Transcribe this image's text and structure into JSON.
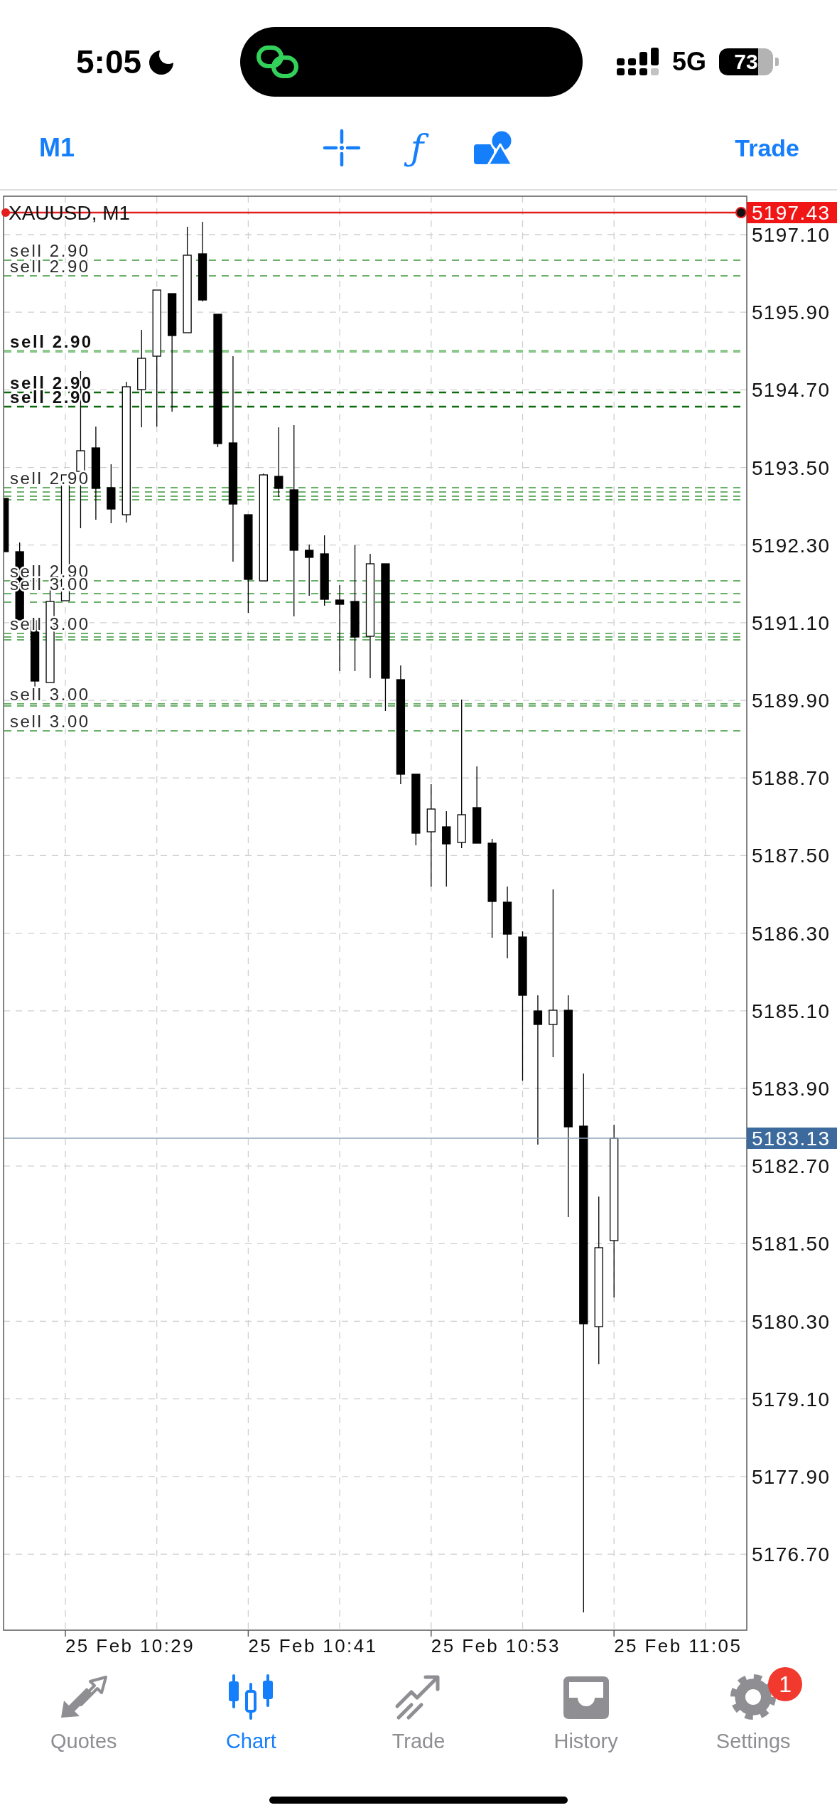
{
  "status_bar": {
    "time": "5:05",
    "network": "5G",
    "battery": "73"
  },
  "toolbar": {
    "timeframe": "M1",
    "function_button": "ƒ",
    "trade_button": "Trade"
  },
  "chart": {
    "symbol": "XAUUSD, M1",
    "price_line_tag": "5197.43",
    "current_price_tag": "5183.13",
    "order_lines": [
      {
        "label": "sell 2.90",
        "kind": "thin"
      },
      {
        "label": "sell 2.90",
        "kind": "thin"
      },
      {
        "label": "sell 2.90",
        "kind": "heavy"
      },
      {
        "label": "sell 2.90",
        "kind": "dark"
      },
      {
        "label": "sell 2.90",
        "kind": "dark"
      },
      {
        "label": "sell 2.90",
        "kind": "thin"
      },
      {
        "kind": "thin"
      },
      {
        "kind": "thin"
      },
      {
        "kind": "thin"
      },
      {
        "label": "sell 2.90",
        "kind": "thin"
      },
      {
        "label": "sell 3.00",
        "kind": "thin"
      },
      {
        "kind": "thin"
      },
      {
        "label": "sell 3.00",
        "kind": "thin"
      },
      {
        "kind": "thin"
      },
      {
        "kind": "thin"
      },
      {
        "label": "sell 3.00",
        "kind": "thin"
      },
      {
        "kind": "thin"
      },
      {
        "label": "sell 3.00",
        "kind": "thin"
      }
    ],
    "price_axis": [
      "5197.10",
      "5195.90",
      "5194.70",
      "5193.50",
      "5192.30",
      "5191.10",
      "5189.90",
      "5188.70",
      "5187.50",
      "5186.30",
      "5185.10",
      "5183.90",
      "5182.70",
      "5181.50",
      "5180.30",
      "5179.10",
      "5177.90",
      "5176.70"
    ],
    "time_axis": [
      "25 Feb 10:29",
      "25 Feb 10:41",
      "25 Feb 10:53",
      "25 Feb 11:05"
    ]
  },
  "tabs": [
    {
      "label": "Quotes",
      "selected": false
    },
    {
      "label": "Chart",
      "selected": true
    },
    {
      "label": "Trade",
      "selected": false
    },
    {
      "label": "History",
      "selected": false
    },
    {
      "label": "Settings",
      "selected": false,
      "badge": "1"
    }
  ]
}
